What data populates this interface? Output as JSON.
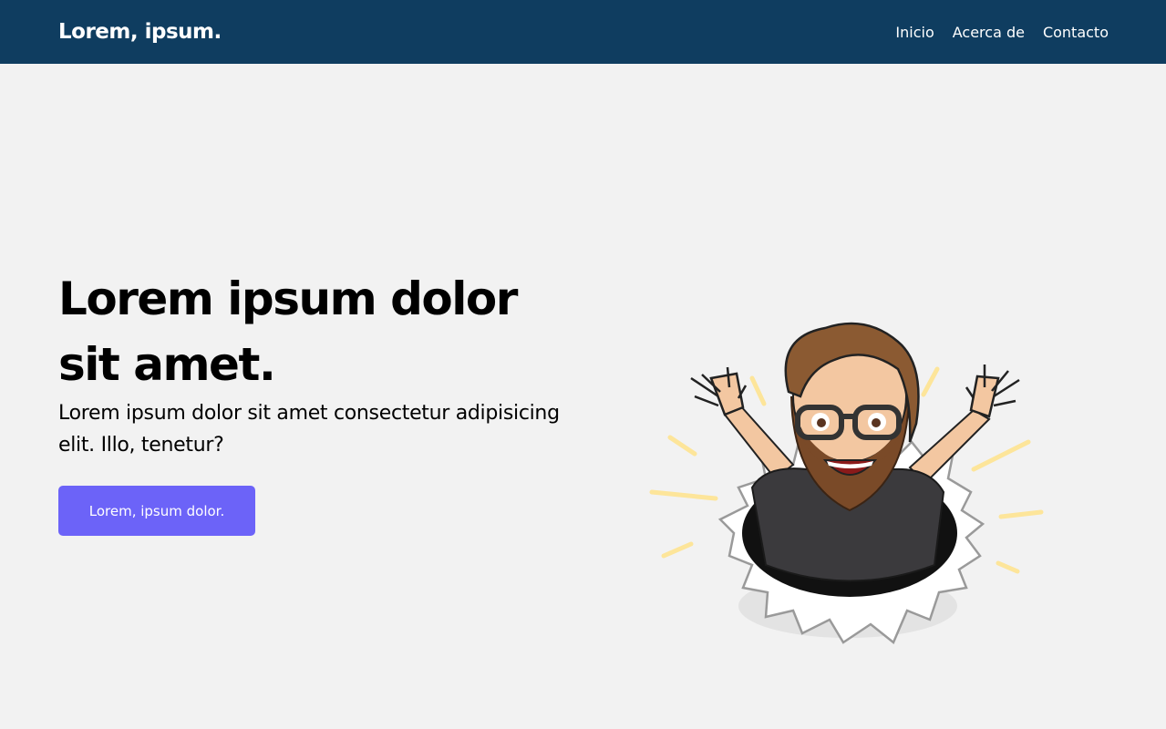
{
  "navbar": {
    "brand": "Lorem, ipsum.",
    "links": [
      "Inicio",
      "Acerca de",
      "Contacto"
    ]
  },
  "hero": {
    "title": "Lorem ipsum dolor sit amet.",
    "subtitle": "Lorem ipsum dolor sit amet consectetur adipisicing elit. Illo, tenetur?",
    "button_label": "Lorem, ipsum dolor."
  },
  "colors": {
    "navbar_bg": "#0f3d60",
    "page_bg": "#f2f2f2",
    "button_bg": "#6c63f8"
  },
  "icons": {
    "illustration": "cartoon-avatar-bursting-through-paper"
  }
}
